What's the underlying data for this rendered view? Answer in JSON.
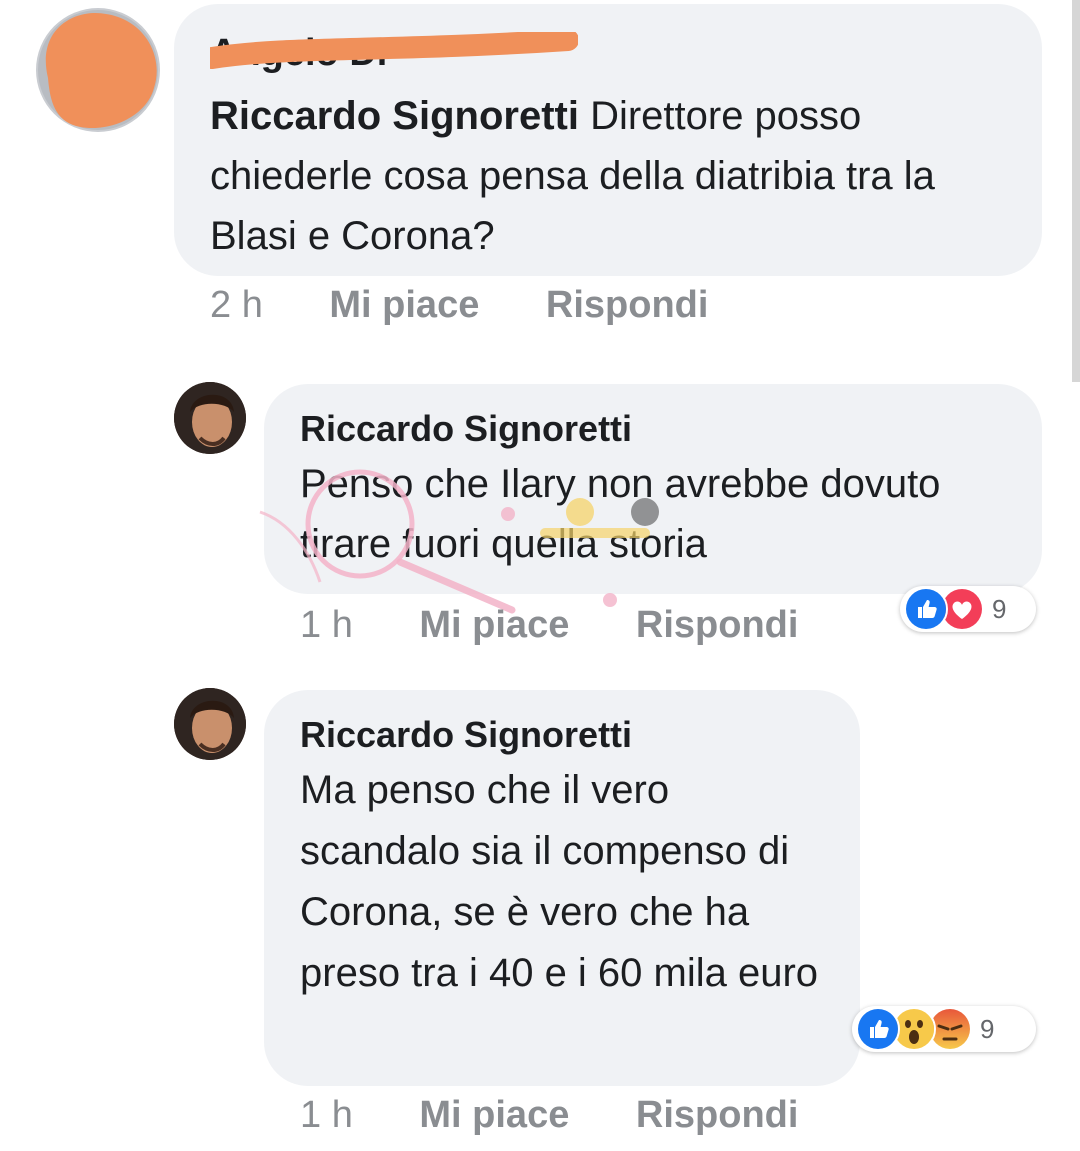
{
  "comment1": {
    "author_scribbled": "Angelo Di",
    "reply_name": "Riccardo Signoretti",
    "text": " Direttore posso chiederle cosa pensa della diatribia tra la Blasi e Corona?",
    "time": "2 h",
    "like_label": "Mi piace",
    "reply_label": "Rispondi"
  },
  "reply1": {
    "author": "Riccardo Signoretti",
    "text": "Penso che Ilary non avrebbe dovuto tirare fuori quella storia",
    "time": "1 h",
    "like_label": "Mi piace",
    "reply_label": "Rispondi",
    "reaction_count": "9",
    "reactions": [
      "like-icon",
      "love-icon"
    ]
  },
  "reply2": {
    "author": "Riccardo Signoretti",
    "text": "Ma penso che il vero scandalo sia il compenso di Corona, se è vero che ha preso tra i 40 e i 60 mila euro",
    "time": "1 h",
    "like_label": "Mi piace",
    "reply_label": "Rispondi",
    "reaction_count": "9",
    "reactions": [
      "like-icon",
      "wow-icon",
      "angry-icon"
    ]
  },
  "colors": {
    "bubble": "#f0f2f5",
    "meta_text": "#8a8d91",
    "like_blue": "#1877f2",
    "love_red": "#f33e58",
    "scribble_orange": "#f0905a"
  }
}
